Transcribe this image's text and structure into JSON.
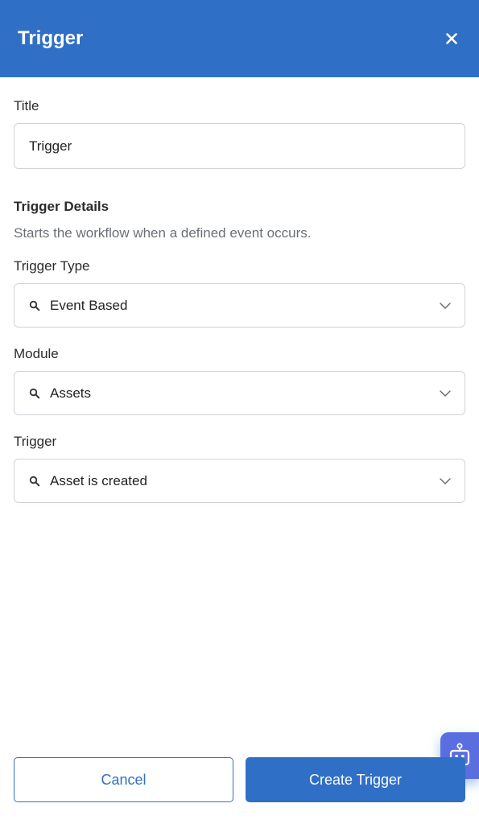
{
  "header": {
    "title": "Trigger",
    "close_icon": "close-icon"
  },
  "form": {
    "title_label": "Title",
    "title_value": "Trigger",
    "section_heading": "Trigger Details",
    "section_description": "Starts the workflow when a defined event occurs.",
    "fields": [
      {
        "label": "Trigger Type",
        "value": "Event Based"
      },
      {
        "label": "Module",
        "value": "Assets"
      },
      {
        "label": "Trigger",
        "value": "Asset is created"
      }
    ]
  },
  "footer": {
    "cancel_label": "Cancel",
    "submit_label": "Create Trigger"
  },
  "assistant": {
    "icon": "robot-icon"
  },
  "colors": {
    "accent": "#2f6fc6",
    "border": "#cfd3d9",
    "muted_text": "#6b6f75"
  }
}
